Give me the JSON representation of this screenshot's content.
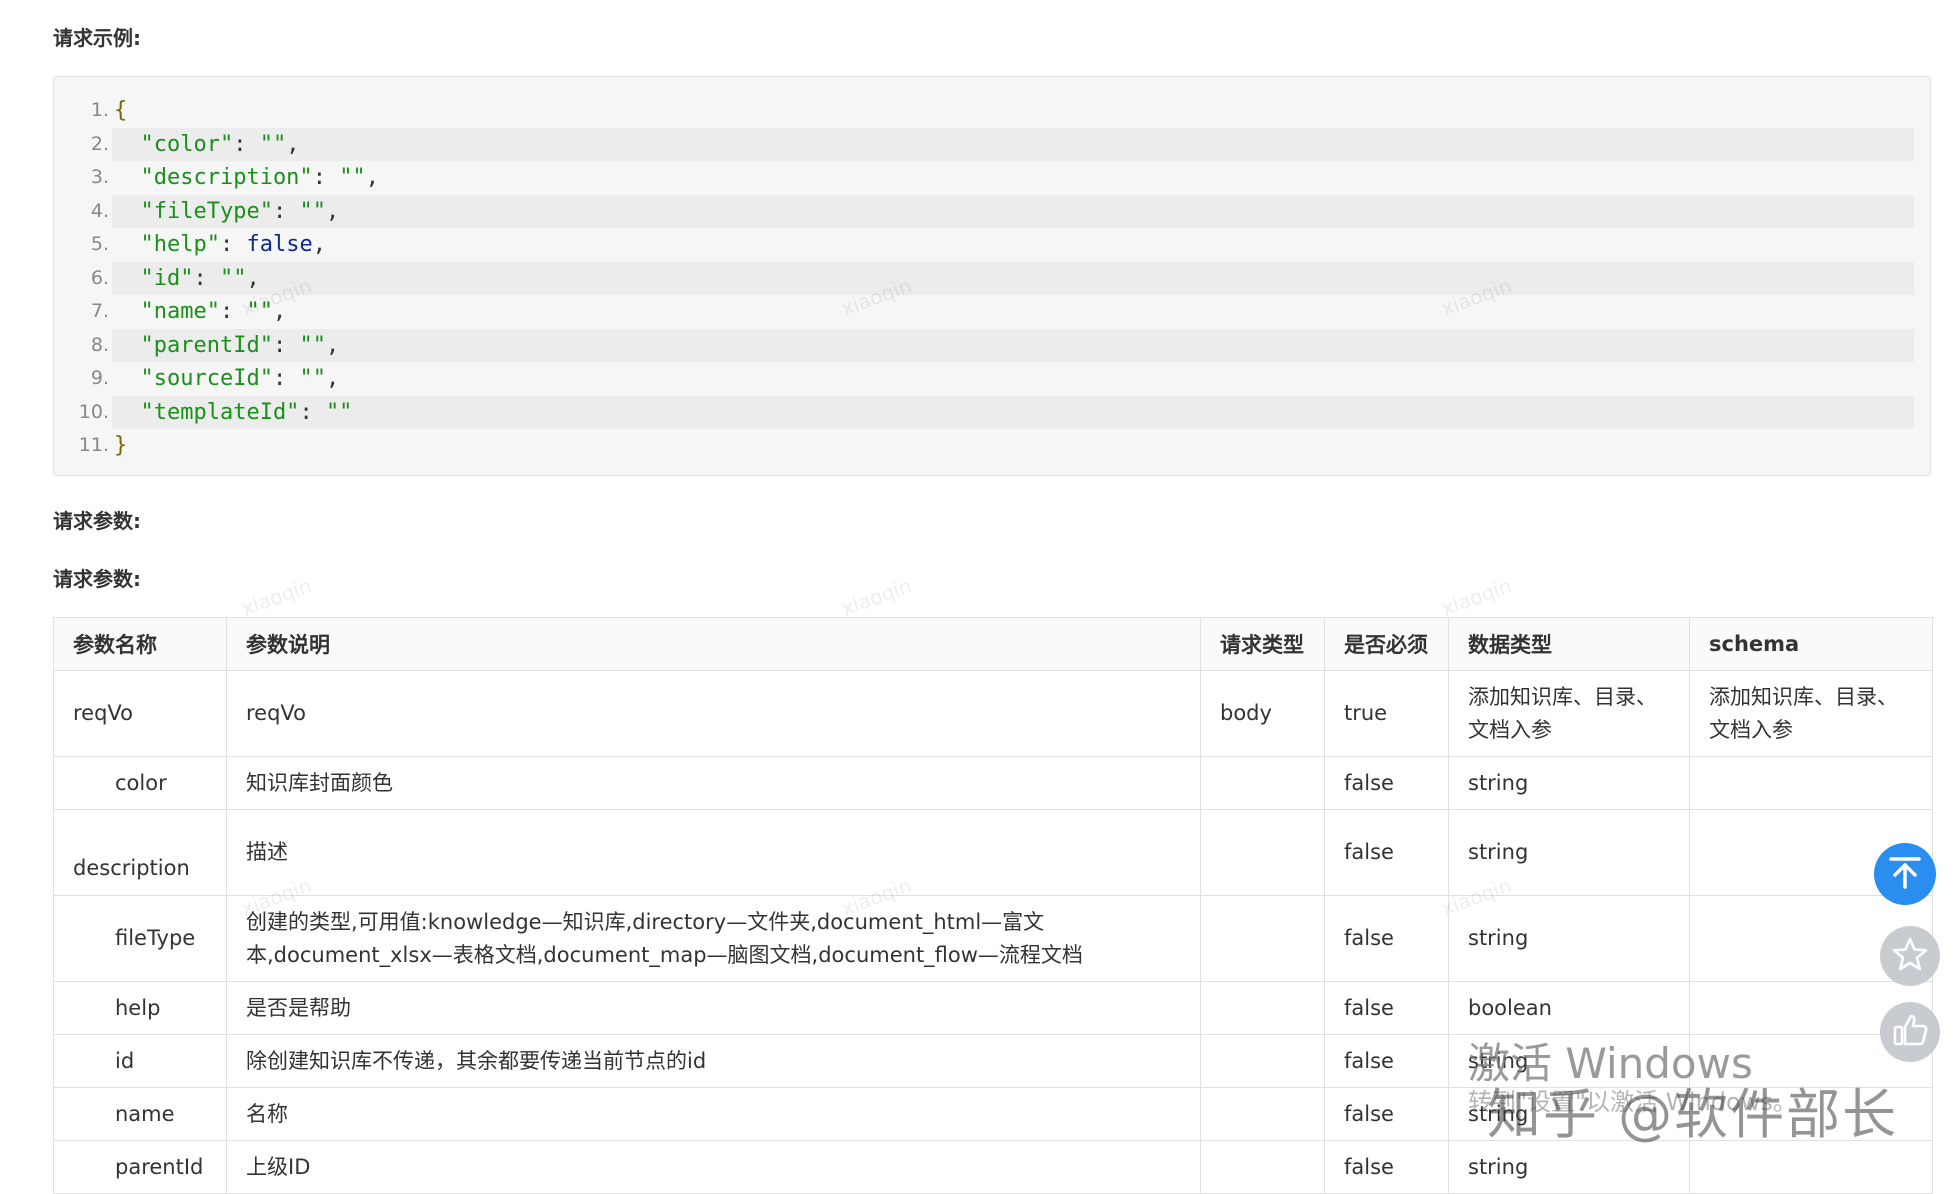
{
  "sections": {
    "request_example_title": "请求示例:",
    "request_params_title_1": "请求参数:",
    "request_params_title_2": "请求参数:"
  },
  "code": {
    "lines": [
      {
        "n": "1.",
        "parts": [
          {
            "t": "brace",
            "v": "{"
          }
        ]
      },
      {
        "n": "2.",
        "parts": [
          {
            "t": "key",
            "v": "  \"color\""
          },
          {
            "t": "punc",
            "v": ": "
          },
          {
            "t": "str",
            "v": "\"\""
          },
          {
            "t": "punc",
            "v": ","
          }
        ]
      },
      {
        "n": "3.",
        "parts": [
          {
            "t": "key",
            "v": "  \"description\""
          },
          {
            "t": "punc",
            "v": ": "
          },
          {
            "t": "str",
            "v": "\"\""
          },
          {
            "t": "punc",
            "v": ","
          }
        ]
      },
      {
        "n": "4.",
        "parts": [
          {
            "t": "key",
            "v": "  \"fileType\""
          },
          {
            "t": "punc",
            "v": ": "
          },
          {
            "t": "str",
            "v": "\"\""
          },
          {
            "t": "punc",
            "v": ","
          }
        ]
      },
      {
        "n": "5.",
        "parts": [
          {
            "t": "key",
            "v": "  \"help\""
          },
          {
            "t": "punc",
            "v": ": "
          },
          {
            "t": "bool",
            "v": "false"
          },
          {
            "t": "punc",
            "v": ","
          }
        ]
      },
      {
        "n": "6.",
        "parts": [
          {
            "t": "key",
            "v": "  \"id\""
          },
          {
            "t": "punc",
            "v": ": "
          },
          {
            "t": "str",
            "v": "\"\""
          },
          {
            "t": "punc",
            "v": ","
          }
        ]
      },
      {
        "n": "7.",
        "parts": [
          {
            "t": "key",
            "v": "  \"name\""
          },
          {
            "t": "punc",
            "v": ": "
          },
          {
            "t": "str",
            "v": "\"\""
          },
          {
            "t": "punc",
            "v": ","
          }
        ]
      },
      {
        "n": "8.",
        "parts": [
          {
            "t": "key",
            "v": "  \"parentId\""
          },
          {
            "t": "punc",
            "v": ": "
          },
          {
            "t": "str",
            "v": "\"\""
          },
          {
            "t": "punc",
            "v": ","
          }
        ]
      },
      {
        "n": "9.",
        "parts": [
          {
            "t": "key",
            "v": "  \"sourceId\""
          },
          {
            "t": "punc",
            "v": ": "
          },
          {
            "t": "str",
            "v": "\"\""
          },
          {
            "t": "punc",
            "v": ","
          }
        ]
      },
      {
        "n": "10.",
        "parts": [
          {
            "t": "key",
            "v": "  \"templateId\""
          },
          {
            "t": "punc",
            "v": ": "
          },
          {
            "t": "str",
            "v": "\"\""
          }
        ]
      },
      {
        "n": "11.",
        "parts": [
          {
            "t": "brace",
            "v": "}"
          }
        ]
      }
    ]
  },
  "table": {
    "headers": [
      "参数名称",
      "参数说明",
      "请求类型",
      "是否必须",
      "数据类型",
      "schema"
    ],
    "rows": [
      {
        "name": "reqVo",
        "desc": "reqVo",
        "type": "body",
        "required": "true",
        "dtype": "添加知识库、目录、文档入参",
        "schema": "添加知识库、目录、文档入参"
      },
      {
        "name": "color",
        "desc": "知识库封面颜色",
        "type": "",
        "required": "false",
        "dtype": "string",
        "schema": ""
      },
      {
        "name": "description",
        "desc": "描述",
        "type": "",
        "required": "false",
        "dtype": "string",
        "schema": ""
      },
      {
        "name": "fileType",
        "desc": "创建的类型,可用值:knowledge—知识库,directory—文件夹,document_html—富文本,document_xlsx—表格文档,document_map—脑图文档,document_flow—流程文档",
        "type": "",
        "required": "false",
        "dtype": "string",
        "schema": ""
      },
      {
        "name": "help",
        "desc": "是否是帮助",
        "type": "",
        "required": "false",
        "dtype": "boolean",
        "schema": ""
      },
      {
        "name": "id",
        "desc": "除创建知识库不传递，其余都要传递当前节点的id",
        "type": "",
        "required": "false",
        "dtype": "string",
        "schema": ""
      },
      {
        "name": "name",
        "desc": "名称",
        "type": "",
        "required": "false",
        "dtype": "string",
        "schema": ""
      },
      {
        "name": "parentId",
        "desc": "上级ID",
        "type": "",
        "required": "false",
        "dtype": "string",
        "schema": ""
      }
    ]
  },
  "watermark": "xiaoqin",
  "overlay": {
    "activate_windows": "激活 Windows",
    "activate_sub": "转到\"设置\"以激活 Windows。",
    "credit": "知乎 @软件部长"
  },
  "icons": {
    "back_to_top": "arrow-up-icon",
    "favorite": "star-icon",
    "like": "thumbs-up-icon"
  },
  "colors": {
    "code_key": "#1a8f1a",
    "code_bool": "#0b2b8f",
    "back_to_top_bg": "#2a8df0",
    "fab_gray": "#c8cbd0"
  }
}
